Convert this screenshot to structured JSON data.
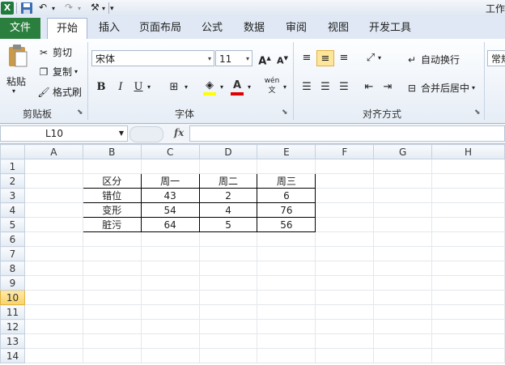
{
  "window": {
    "title": "工作"
  },
  "tabs": {
    "file": "文件",
    "items": [
      "开始",
      "插入",
      "页面布局",
      "公式",
      "数据",
      "审阅",
      "视图",
      "开发工具"
    ]
  },
  "clipboard": {
    "paste": "粘贴",
    "cut": "剪切",
    "copy": "复制",
    "format_painter": "格式刷",
    "label": "剪贴板"
  },
  "font": {
    "name": "宋体",
    "size": "11",
    "bold": "B",
    "italic": "I",
    "underline": "U",
    "phonetic": "wén",
    "label": "字体"
  },
  "alignment": {
    "wrap_text": "自动换行",
    "merge_center": "合并后居中",
    "label": "对齐方式"
  },
  "number": {
    "format": "常规"
  },
  "formula_bar": {
    "name_box": "L10",
    "fx": "fx",
    "value": ""
  },
  "grid": {
    "columns": [
      "A",
      "B",
      "C",
      "D",
      "E",
      "F",
      "G",
      "H"
    ],
    "rows": [
      "1",
      "2",
      "3",
      "4",
      "5",
      "6",
      "7",
      "8",
      "9",
      "10",
      "11",
      "12",
      "13",
      "14"
    ],
    "selected_row": "10",
    "table": [
      [
        "区分",
        "周一",
        "周二",
        "周三"
      ],
      [
        "错位",
        "43",
        "2",
        "6"
      ],
      [
        "变形",
        "54",
        "4",
        "76"
      ],
      [
        "脏污",
        "64",
        "5",
        "56"
      ]
    ]
  }
}
